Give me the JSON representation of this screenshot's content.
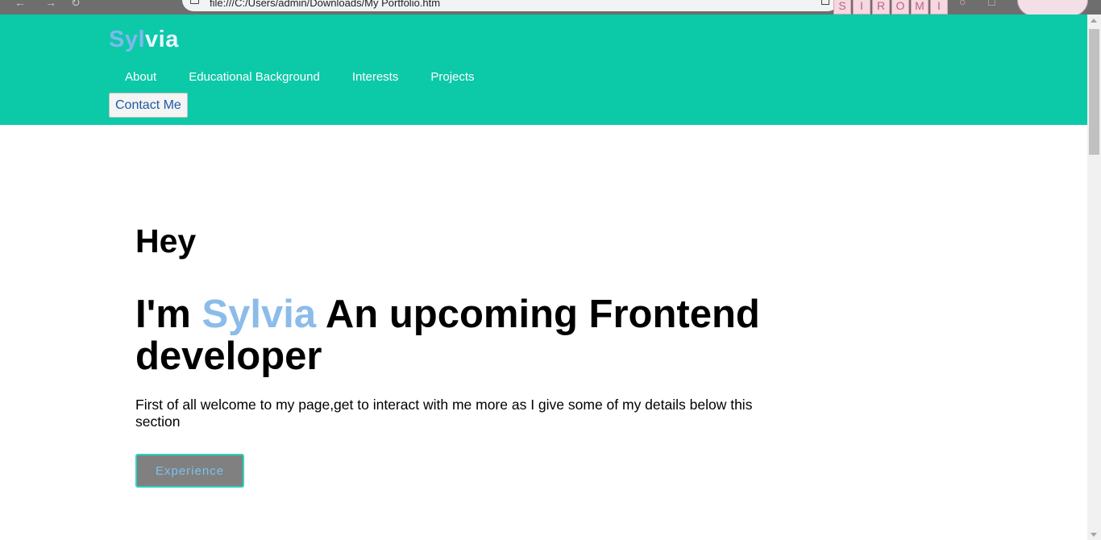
{
  "browser": {
    "url": "file:///C:/Users/admin/Downloads/My Portfolio.htm",
    "extension_letters": [
      "S",
      "I",
      "R",
      "O",
      "M",
      "I"
    ]
  },
  "header": {
    "logo_accent": "Syl",
    "logo_rest": "via",
    "nav": [
      {
        "label": "About"
      },
      {
        "label": "Educational Background"
      },
      {
        "label": "Interests"
      },
      {
        "label": "Projects"
      }
    ],
    "contact_label": "Contact Me"
  },
  "hero": {
    "greeting": "Hey",
    "title_prefix": "I'm ",
    "title_name": "Sylvia",
    "title_suffix": " An upcoming Frontend developer",
    "intro": "First of all welcome to my page,get to interact with me more as I give some of my details below this section",
    "button_label": "Experience"
  },
  "colors": {
    "header_bg": "#0cc9a8",
    "accent": "#8bbcea",
    "button_bg": "#808080",
    "button_border": "#2ed3bd"
  }
}
